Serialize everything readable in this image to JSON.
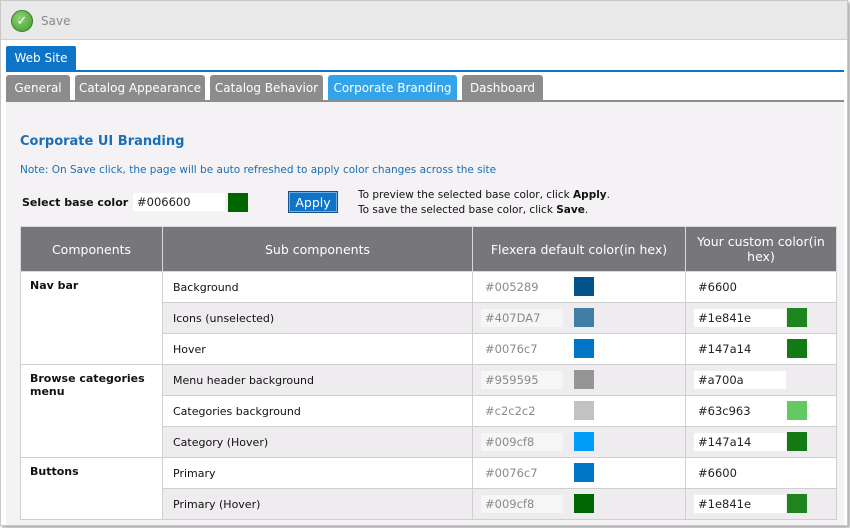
{
  "toolbar": {
    "save_label": "Save",
    "save_icon": "checkmark-circle-icon"
  },
  "site_tab": "Web Site",
  "subtabs": [
    {
      "label": "General",
      "active": false
    },
    {
      "label": "Catalog Appearance",
      "active": false
    },
    {
      "label": "Catalog Behavior",
      "active": false
    },
    {
      "label": "Corporate Branding",
      "active": true
    },
    {
      "label": "Dashboard",
      "active": false
    }
  ],
  "branding": {
    "title": "Corporate UI Branding",
    "note": "Note: On Save click, the page will be auto refreshed to apply color changes across the site",
    "base_color_label": "Select base color :",
    "base_color_value": "#006600",
    "base_color_swatch": "#006600",
    "apply_label": "Apply",
    "hint1_pre": "To preview the selected base color, click ",
    "hint1_bold": "Apply",
    "hint1_post": ".",
    "hint2_pre": "To save the selected base color, click ",
    "hint2_bold": "Save",
    "hint2_post": "."
  },
  "table": {
    "headers": [
      "Components",
      "Sub components",
      "Flexera default color(in hex)",
      "Your custom color(in hex)"
    ],
    "groups": [
      {
        "component": "Nav bar",
        "rows": [
          {
            "sub": "Background",
            "default_hex": "#005289",
            "default_swatch": "#005289",
            "custom_hex": "#6600",
            "custom_swatch": ""
          },
          {
            "sub": "Icons (unselected)",
            "default_hex": "#407DA7",
            "default_swatch": "#407DA7",
            "custom_hex": "#1e841e",
            "custom_swatch": "#1e841e"
          },
          {
            "sub": "Hover",
            "default_hex": "#0076c7",
            "default_swatch": "#0076c7",
            "custom_hex": "#147a14",
            "custom_swatch": "#147a14"
          }
        ]
      },
      {
        "component": "Browse categories menu",
        "rows": [
          {
            "sub": "Menu header background",
            "default_hex": "#959595",
            "default_swatch": "#959595",
            "custom_hex": "#a700a",
            "custom_swatch": ""
          },
          {
            "sub": "Categories background",
            "default_hex": "#c2c2c2",
            "default_swatch": "#c2c2c2",
            "custom_hex": "#63c963",
            "custom_swatch": "#63c963"
          },
          {
            "sub": "Category (Hover)",
            "default_hex": "#009cf8",
            "default_swatch": "#009cf8",
            "custom_hex": "#147a14",
            "custom_swatch": "#147a14"
          }
        ]
      },
      {
        "component": "Buttons",
        "rows": [
          {
            "sub": "Primary",
            "default_hex": "#0076c7",
            "default_swatch": "#0076c7",
            "custom_hex": "#6600",
            "custom_swatch": ""
          },
          {
            "sub": "Primary (Hover)",
            "default_hex": "#009cf8",
            "default_swatch": "#006600",
            "custom_hex": "#1e841e",
            "custom_swatch": "#1e841e"
          }
        ]
      }
    ]
  }
}
